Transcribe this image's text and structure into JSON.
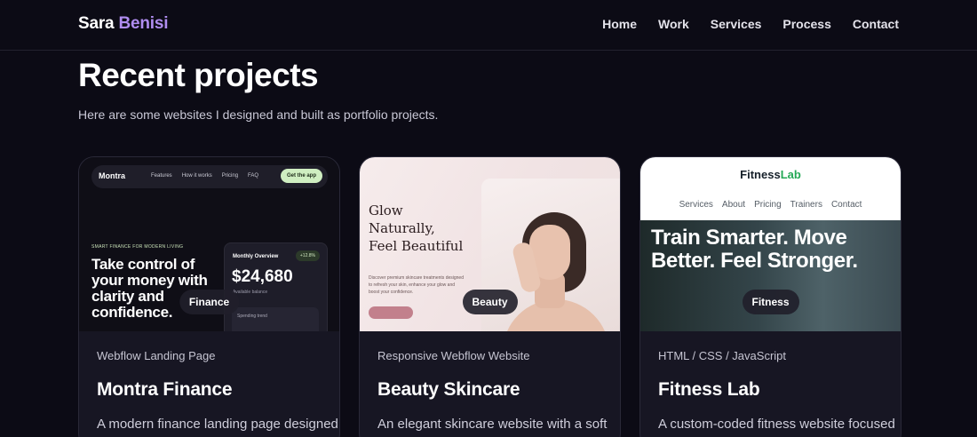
{
  "brand": {
    "first": "Sara",
    "last": "Benisi",
    "accent_color": "#b08df0"
  },
  "nav": [
    "Home",
    "Work",
    "Services",
    "Process",
    "Contact"
  ],
  "hero": {
    "title": "Recent projects",
    "subtitle": "Here are some websites I designed and built as portfolio projects."
  },
  "cards": [
    {
      "category": "Finance",
      "type": "Webflow Landing Page",
      "title": "Montra Finance",
      "description": "A modern finance landing page designed",
      "preview": {
        "logo": "Montra",
        "links": [
          "Features",
          "How it works",
          "Pricing",
          "FAQ"
        ],
        "cta": "Get the app",
        "eyebrow": "SMART FINANCE FOR MODERN LIVING",
        "headline": "Take control of your money with clarity and confidence.",
        "panel_label": "Monthly Overview",
        "panel_badge": "+12.8%",
        "amount": "$24,680",
        "amount_caption": "Available balance",
        "spending_label": "Spending trend"
      }
    },
    {
      "category": "Beauty",
      "type": "Responsive Webflow Website",
      "title": "Beauty Skincare",
      "description": "An elegant skincare website with a soft",
      "preview": {
        "headline": "Glow Naturally, Feel Beautiful",
        "copy": "Discover premium skincare treatments designed to refresh your skin, enhance your glow and boost your confidence."
      }
    },
    {
      "category": "Fitness",
      "type": "HTML / CSS / JavaScript",
      "title": "Fitness Lab",
      "description": "A custom-coded fitness website focused",
      "preview": {
        "logo_a": "Fitness",
        "logo_b": "Lab",
        "links": [
          "Services",
          "About",
          "Pricing",
          "Trainers",
          "Contact"
        ],
        "headline": "Train Smarter. Move Better. Feel Stronger."
      }
    }
  ]
}
